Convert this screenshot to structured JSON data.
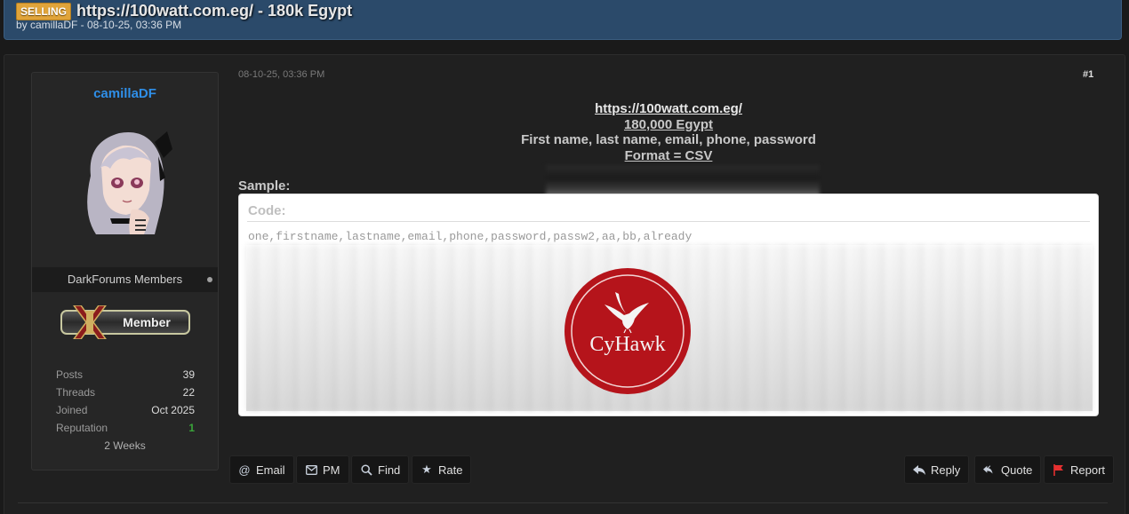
{
  "thread": {
    "prefix": "SELLING",
    "title": "https://100watt.com.eg/ - 180k Egypt",
    "meta": "by camillaDF - 08-10-25, 03:36 PM"
  },
  "author": {
    "name": "camillaDF",
    "group": "DarkForums Members",
    "rank_label": "Member",
    "stats": [
      {
        "label": "Posts",
        "value": "39"
      },
      {
        "label": "Threads",
        "value": "22"
      },
      {
        "label": "Joined",
        "value": "Oct 2025"
      },
      {
        "label": "Reputation",
        "value": "1"
      }
    ],
    "since": "2 Weeks"
  },
  "post": {
    "date": "08-10-25, 03:36 PM",
    "number": "#1",
    "lines": {
      "url": "https://100watt.com.eg/",
      "count": "180,000 Egypt",
      "fields": "First name, last name, email, phone, password",
      "format": "Format = CSV"
    },
    "sample_label": "Sample:",
    "code": {
      "title": "Code:",
      "header_line": "one,firstname,lastname,email,phone,password,passw2,aa,bb,already"
    },
    "watermark": "CyHawk"
  },
  "actions": {
    "left": [
      {
        "label": "Email",
        "icon": "at-icon"
      },
      {
        "label": "PM",
        "icon": "envelope-icon"
      },
      {
        "label": "Find",
        "icon": "search-icon"
      },
      {
        "label": "Rate",
        "icon": "star-icon"
      }
    ],
    "right": [
      {
        "label": "Reply",
        "icon": "reply-icon"
      },
      {
        "label": "Quote",
        "icon": "quote-icon"
      },
      {
        "label": "Report",
        "icon": "flag-icon"
      }
    ]
  },
  "colors": {
    "header_bg": "#2b4a6a",
    "prefix_badge": "#e0a43a",
    "username": "#2f8fe8",
    "reputation": "#3aa53a",
    "logo_red": "#b5141b"
  }
}
